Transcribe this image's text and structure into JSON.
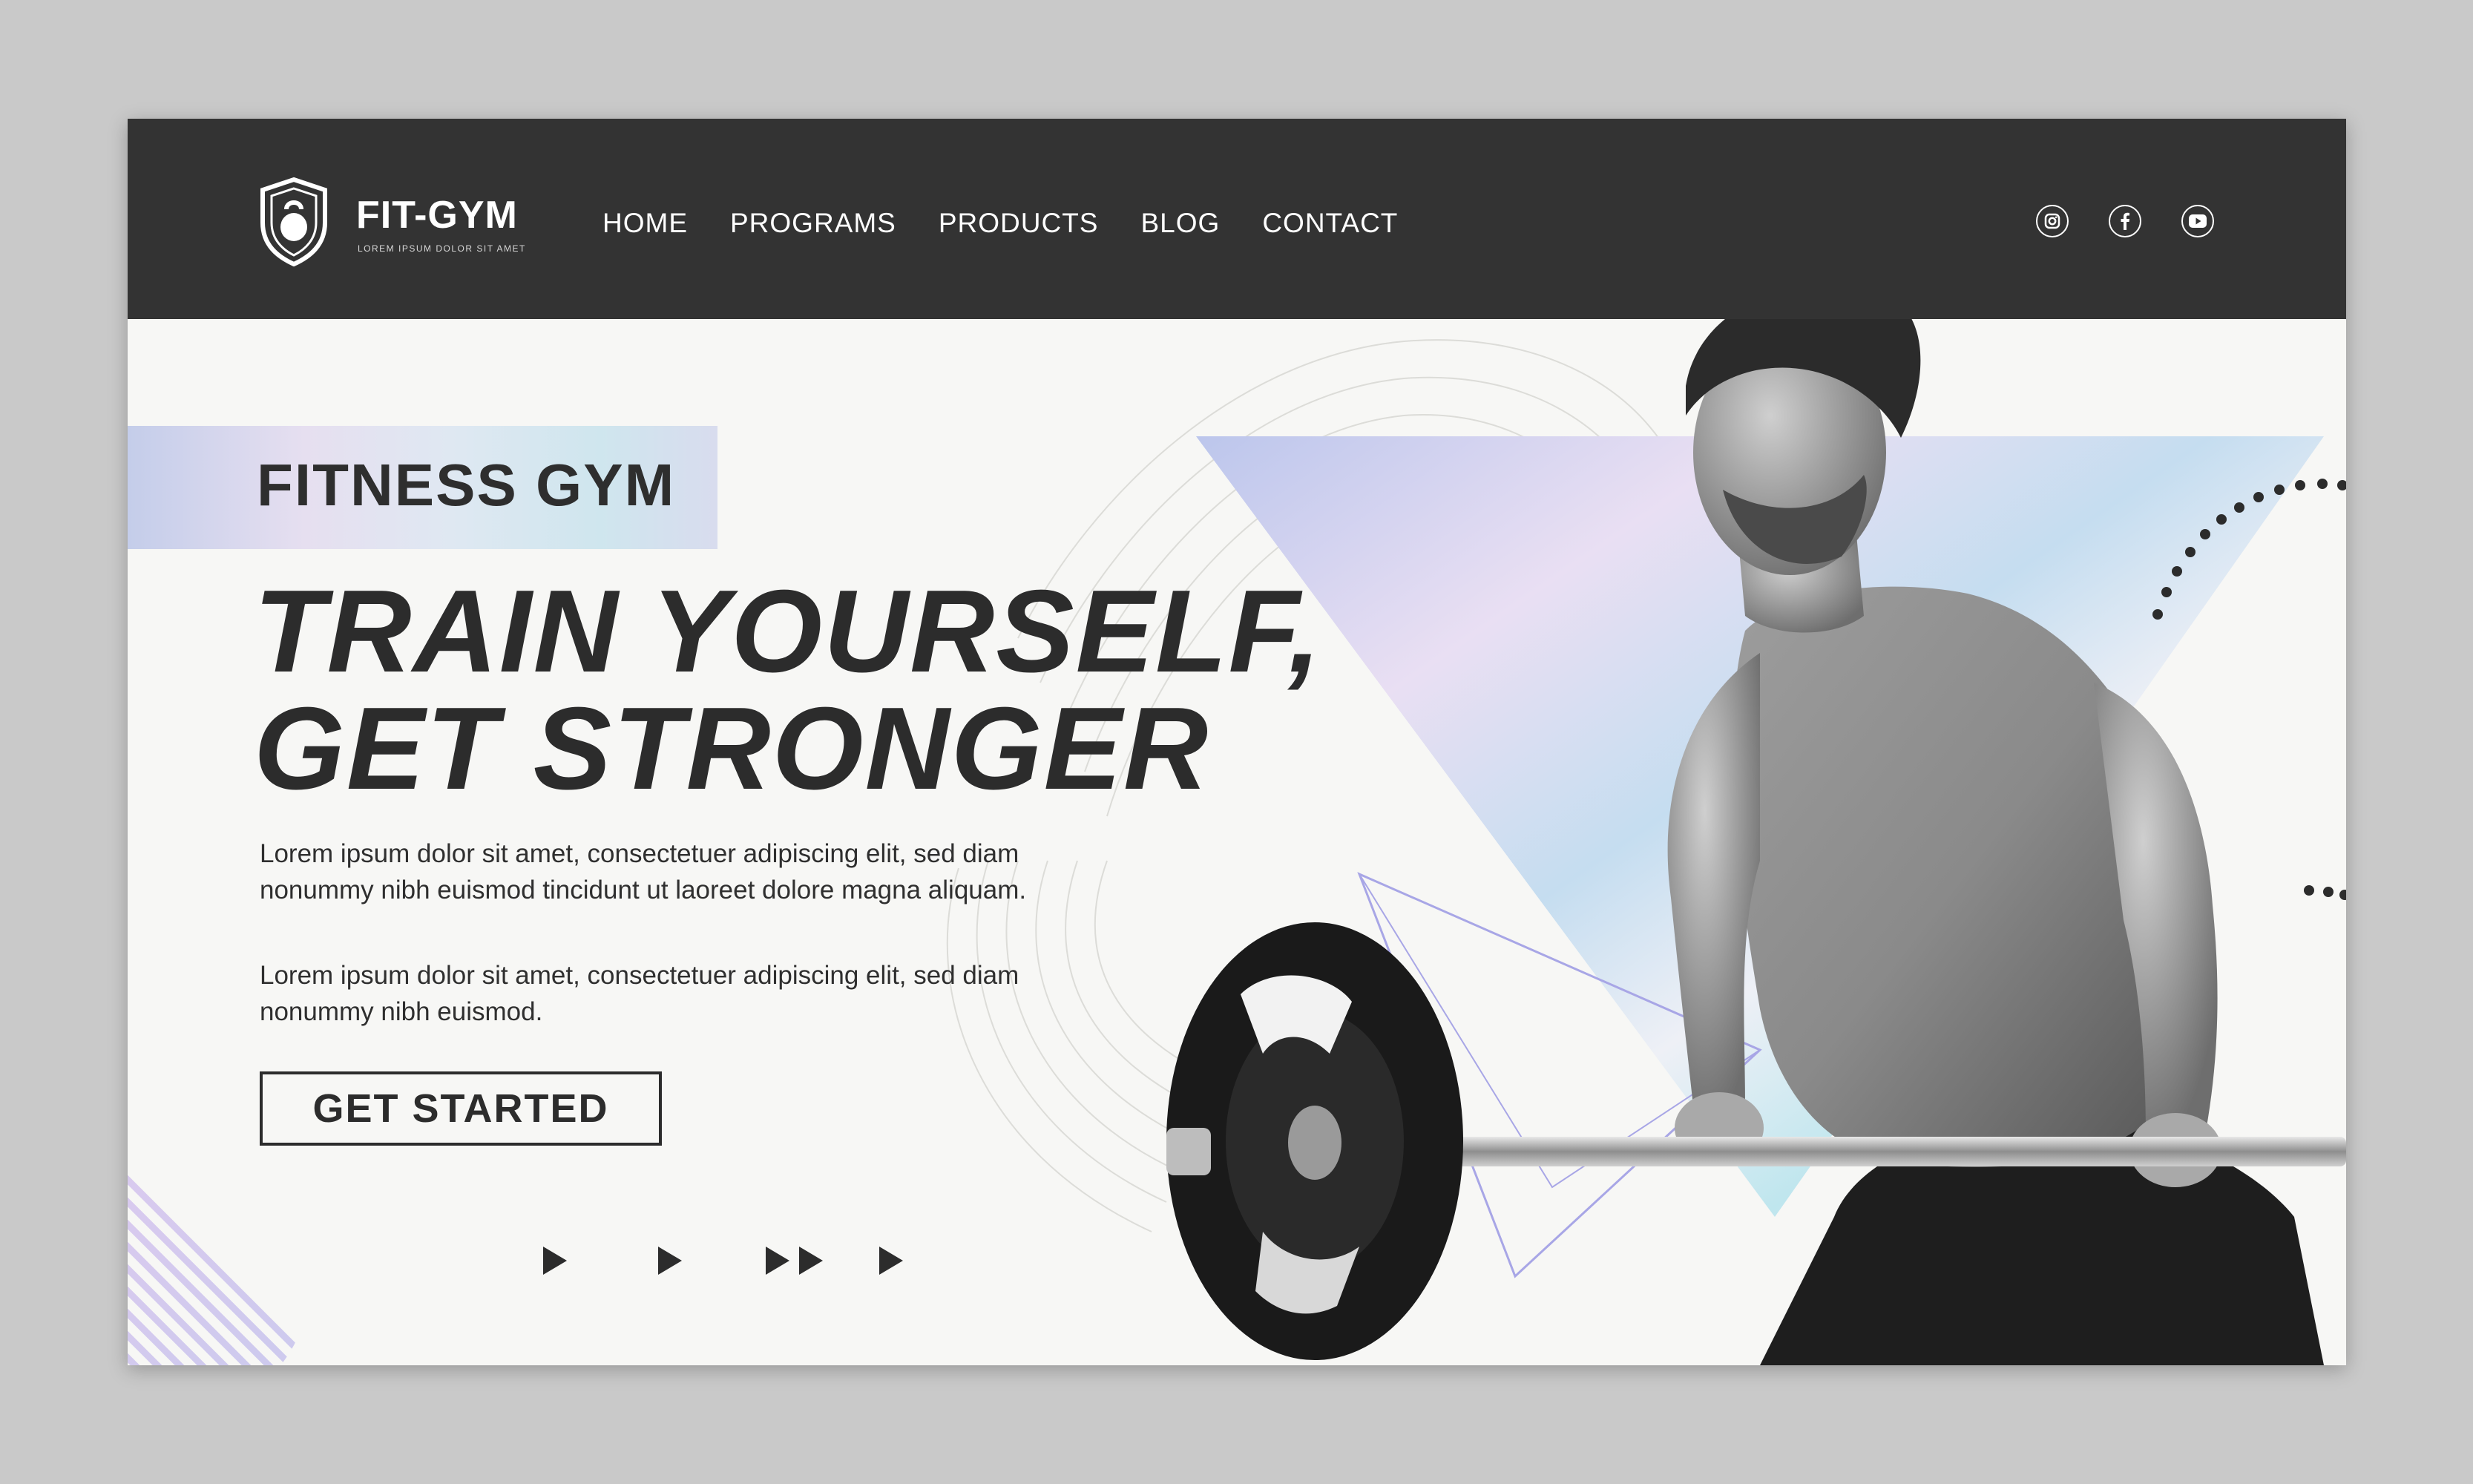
{
  "brand": {
    "name": "FIT-GYM",
    "tagline": "LOREM IPSUM DOLOR SIT AMET"
  },
  "nav": {
    "items": [
      {
        "label": "HOME"
      },
      {
        "label": "PROGRAMS"
      },
      {
        "label": "PRODUCTS"
      },
      {
        "label": "BLOG"
      },
      {
        "label": "CONTACT"
      }
    ],
    "social": [
      "instagram-icon",
      "facebook-icon",
      "youtube-icon"
    ]
  },
  "hero": {
    "tag": "FITNESS GYM",
    "headline_line1": "TRAIN YOURSELF,",
    "headline_line2": "GET STRONGER",
    "paragraph1": "Lorem ipsum dolor sit amet, consectetuer adipiscing elit, sed diam nonummy nibh euismod tincidunt ut laoreet dolore magna aliquam.",
    "paragraph2": "Lorem ipsum dolor sit amet, consectetuer adipiscing elit, sed diam nonummy nibh euismod.",
    "cta_label": "GET STARTED"
  },
  "colors": {
    "nav_bg": "#333333",
    "page_bg": "#f7f7f5",
    "text_dark": "#2c2c2c",
    "holo_accent": "#c9c4ee"
  }
}
